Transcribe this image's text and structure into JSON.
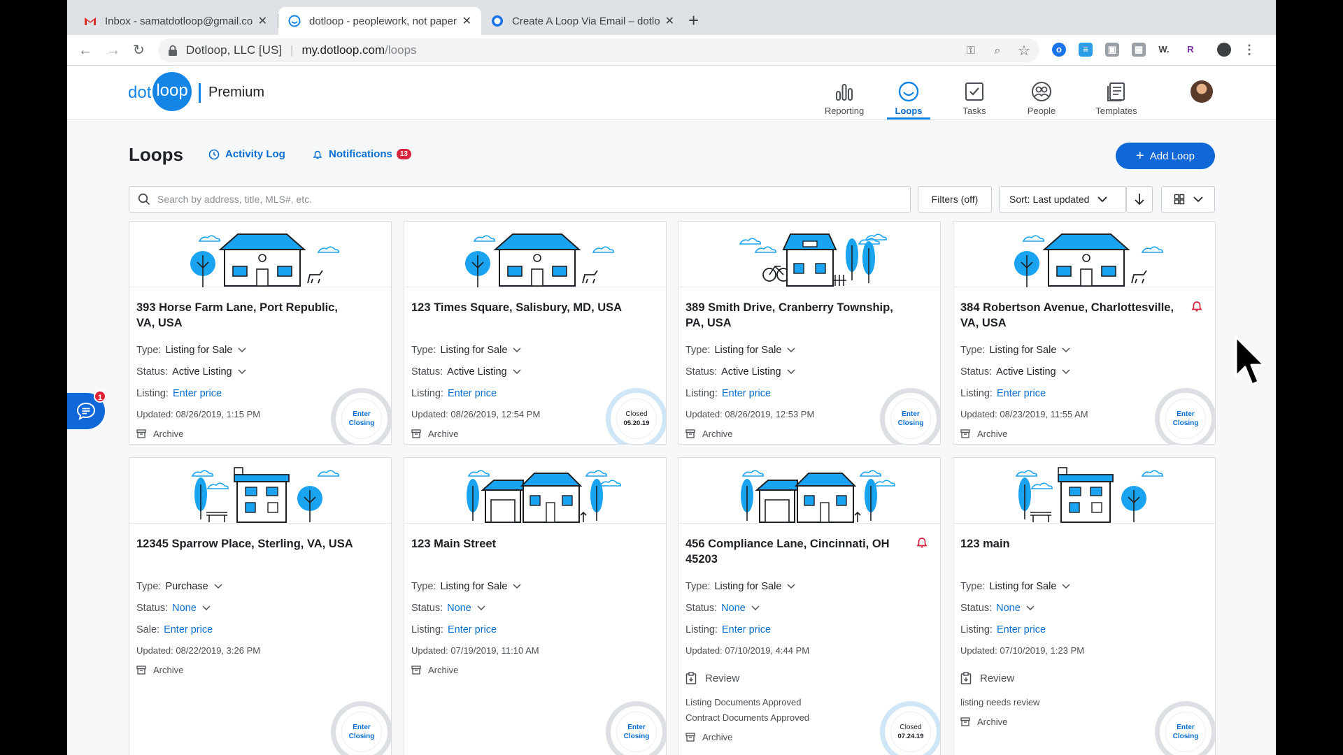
{
  "browser": {
    "tabs": [
      {
        "title": "Inbox - samatdotloop@gmail.com",
        "favicon": "gmail-icon"
      },
      {
        "title": "dotloop - peoplework, not paperwork",
        "favicon": "dotloop-icon",
        "active": true
      },
      {
        "title": "Create A Loop Via Email – dotloop",
        "favicon": "dotloop-help-icon"
      }
    ],
    "address": {
      "site": "Dotloop, LLC [US]",
      "host": "my.dotloop.com",
      "path": "/loops"
    }
  },
  "app": {
    "logo_left": "dot",
    "logo_circle": "loop",
    "plan": "Premium",
    "nav": [
      {
        "label": "Reporting",
        "icon": "bar-chart-icon"
      },
      {
        "label": "Loops",
        "icon": "loop-icon",
        "active": true
      },
      {
        "label": "Tasks",
        "icon": "task-check-icon"
      },
      {
        "label": "People",
        "icon": "people-icon"
      },
      {
        "label": "Templates",
        "icon": "templates-icon"
      }
    ]
  },
  "page": {
    "title": "Loops",
    "activity_log": "Activity Log",
    "notifications": "Notifications",
    "notifications_count": "13",
    "add_loop": "Add Loop",
    "search_placeholder": "Search by address, title, MLS#, etc.",
    "filters": "Filters (off)",
    "sort": "Sort: Last updated"
  },
  "loops": [
    {
      "address": "393 Horse Farm Lane, Port Republic, VA, USA",
      "type": "Listing for Sale",
      "status": "Active Listing",
      "price_label": "Listing:",
      "price": "Enter price",
      "updated": "Updated: 08/26/2019, 1:15 PM",
      "archive": "Archive",
      "closing_line1": "Enter",
      "closing_line2": "Closing"
    },
    {
      "address": "123 Times Square, Salisbury, MD, USA",
      "type": "Listing for Sale",
      "status": "Active Listing",
      "price_label": "Listing:",
      "price": "Enter price",
      "updated": "Updated: 08/26/2019, 12:54 PM",
      "archive": "Archive",
      "closing_line1": "Closed",
      "closing_line2": "05.20.19"
    },
    {
      "address": "389 Smith Drive, Cranberry Township, PA, USA",
      "type": "Listing for Sale",
      "status": "Active Listing",
      "price_label": "Listing:",
      "price": "Enter price",
      "updated": "Updated: 08/26/2019, 12:53 PM",
      "archive": "Archive",
      "closing_line1": "Enter",
      "closing_line2": "Closing"
    },
    {
      "address": "384 Robertson Avenue, Charlottesville, VA, USA",
      "type": "Listing for Sale",
      "status": "Active Listing",
      "price_label": "Listing:",
      "price": "Enter price",
      "updated": "Updated: 08/23/2019, 11:55 AM",
      "archive": "Archive",
      "closing_line1": "Enter",
      "closing_line2": "Closing"
    },
    {
      "address": "12345 Sparrow Place, Sterling, VA, USA",
      "type": "Purchase",
      "status": "None",
      "price_label": "Sale:",
      "price": "Enter price",
      "updated": "Updated: 08/22/2019, 3:26 PM",
      "archive": "Archive",
      "closing_line1": "Enter",
      "closing_line2": "Closing"
    },
    {
      "address": "123 Main Street",
      "type": "Listing for Sale",
      "status": "None",
      "price_label": "Listing:",
      "price": "Enter price",
      "updated": "Updated: 07/19/2019, 11:10 AM",
      "archive": "Archive",
      "closing_line1": "Enter",
      "closing_line2": "Closing"
    },
    {
      "address": "456 Compliance Lane, Cincinnati, OH 45203",
      "type": "Listing for Sale",
      "status": "None",
      "price_label": "Listing:",
      "price": "Enter price",
      "updated": "Updated: 07/10/2019, 4:44 PM",
      "review": "Review",
      "note1": "Listing Documents Approved",
      "note2": "Contract Documents Approved",
      "archive": "Archive",
      "closing_line1": "Closed",
      "closing_line2": "07.24.19"
    },
    {
      "address": "123 main",
      "type": "Listing for Sale",
      "status": "None",
      "price_label": "Listing:",
      "price": "Enter price",
      "updated": "Updated: 07/10/2019, 1:23 PM",
      "review": "Review",
      "note1": "listing needs review",
      "archive": "Archive",
      "closing_line1": "Enter",
      "closing_line2": "Closing"
    }
  ],
  "chat_badge": "1",
  "colors": {
    "brand": "#1485e5",
    "primary": "#1068d8",
    "link": "#0a6fd1",
    "alert": "#d8213a"
  }
}
